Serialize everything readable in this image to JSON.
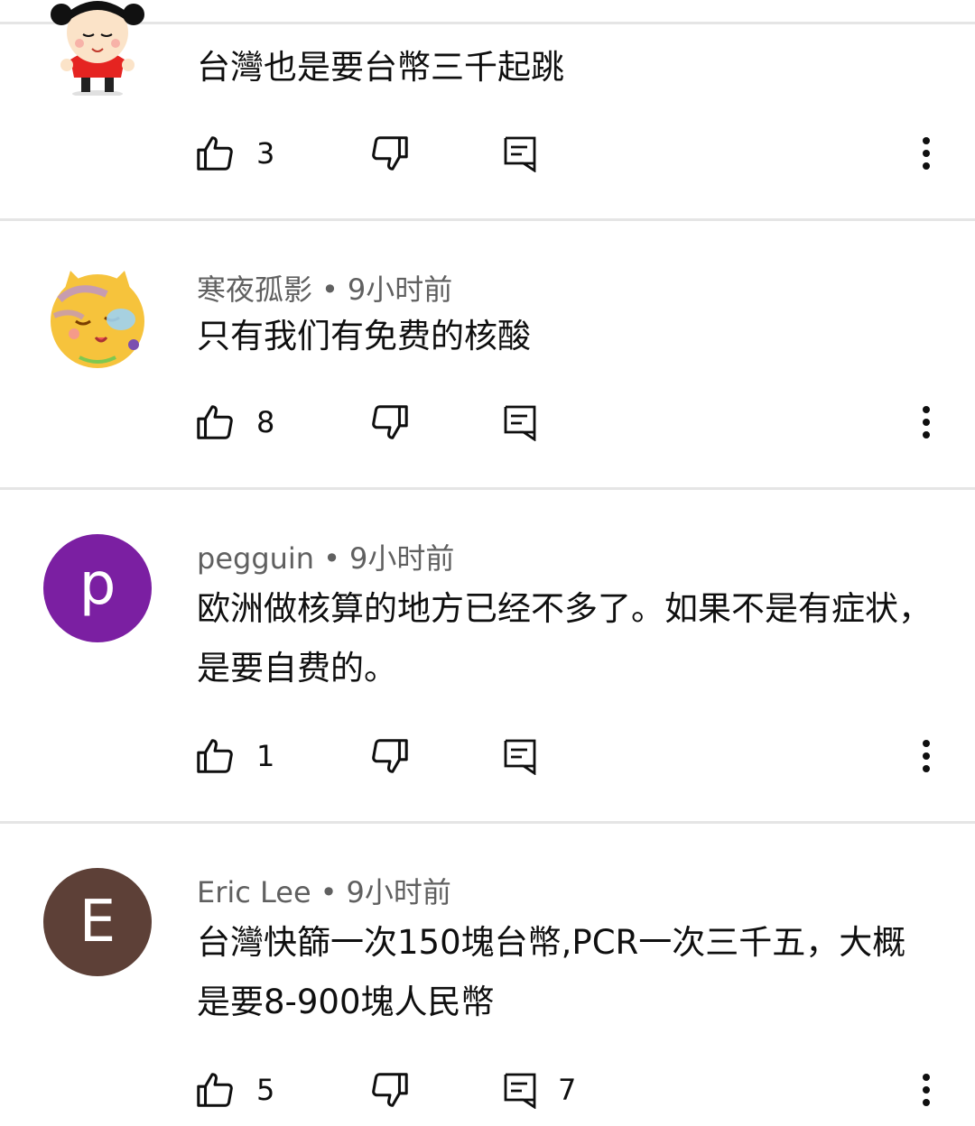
{
  "comments": [
    {
      "author": "",
      "time": "",
      "text": "台灣也是要台幣三千起跳",
      "likes": "3",
      "replies": "",
      "avatar": {
        "type": "image",
        "icon": "pucca-cartoon-avatar"
      }
    },
    {
      "author": "寒夜孤影",
      "time": "9小时前",
      "text": "只有我们有免费的核酸",
      "likes": "8",
      "replies": "",
      "avatar": {
        "type": "image",
        "icon": "cat-cartoon-avatar"
      }
    },
    {
      "author": "pegguin",
      "time": "9小时前",
      "text": "欧洲做核算的地方已经不多了。如果不是有症状，是要自费的。",
      "likes": "1",
      "replies": "",
      "avatar": {
        "type": "letter",
        "letter": "p",
        "color": "#7b1fa2"
      }
    },
    {
      "author": "Eric Lee",
      "time": "9小时前",
      "text": "台灣快篩一次150塊台幣,PCR一次三千五，大概是要8-900塊人民幣",
      "likes": "5",
      "replies": "7",
      "avatar": {
        "type": "letter",
        "letter": "E",
        "color": "#5d4037"
      }
    }
  ],
  "separator": "•"
}
